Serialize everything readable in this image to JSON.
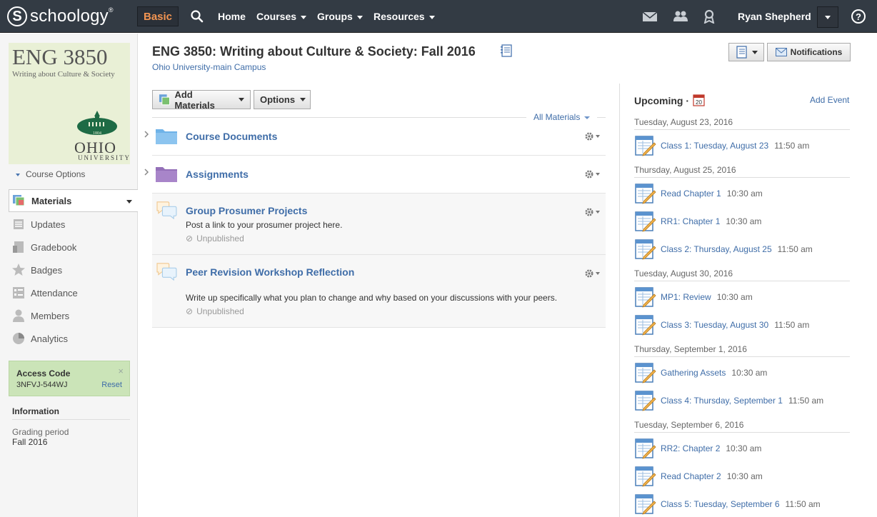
{
  "topbar": {
    "logo_letter": "S",
    "logo_text": "schoology",
    "logo_tm": "®",
    "basic_label": "Basic",
    "nav": {
      "home": "Home",
      "courses": "Courses",
      "groups": "Groups",
      "resources": "Resources"
    },
    "user_name": "Ryan Shepherd",
    "help": "?",
    "icons": [
      "mail-icon",
      "people-icon",
      "award-icon"
    ]
  },
  "sidebar": {
    "course_pic": {
      "code": "ENG 3850",
      "name": "Writing about Culture & Society",
      "ohio": "OHIO",
      "university": "UNIVERSITY",
      "seal_year": "1804"
    },
    "course_options": "Course Options",
    "items": [
      {
        "label": "Materials",
        "icon": "materials-icon"
      },
      {
        "label": "Updates",
        "icon": "updates-icon"
      },
      {
        "label": "Gradebook",
        "icon": "gradebook-icon"
      },
      {
        "label": "Badges",
        "icon": "badge-icon"
      },
      {
        "label": "Attendance",
        "icon": "attendance-icon"
      },
      {
        "label": "Members",
        "icon": "members-icon"
      },
      {
        "label": "Analytics",
        "icon": "analytics-icon"
      }
    ],
    "access": {
      "title": "Access Code",
      "code": "3NFVJ-544WJ",
      "reset": "Reset",
      "close": "×"
    },
    "info": {
      "title": "Information",
      "grading_label": "Grading period",
      "grading_value": "Fall 2016"
    }
  },
  "main": {
    "title": "ENG 3850: Writing about Culture & Society: Fall 2016",
    "campus": "Ohio University-main Campus",
    "notifications": "Notifications",
    "add_materials": "Add Materials",
    "options": "Options",
    "all_materials": "All Materials",
    "materials": [
      {
        "title": "Course Documents",
        "type": "folder",
        "color": "#6fb3e8"
      },
      {
        "title": "Assignments",
        "type": "folder",
        "color": "#a57fc4"
      },
      {
        "title": "Group Prosumer Projects",
        "type": "discussion",
        "desc": "Post a link to your prosumer project here.",
        "status": "Unpublished"
      },
      {
        "title": "Peer Revision Workshop Reflection",
        "type": "discussion",
        "desc": "Write up specifically what you plan to change and why based on your discussions with your peers.",
        "status": "Unpublished"
      }
    ]
  },
  "upcoming": {
    "title": "Upcoming ·",
    "cal_day": "20",
    "add_event": "Add Event",
    "groups": [
      {
        "date": "Tuesday, August 23, 2016",
        "events": [
          {
            "title": "Class 1: Tuesday, August 23",
            "time": "11:50 am"
          }
        ]
      },
      {
        "date": "Thursday, August 25, 2016",
        "events": [
          {
            "title": "Read Chapter 1",
            "time": "10:30 am"
          },
          {
            "title": "RR1: Chapter 1",
            "time": "10:30 am"
          },
          {
            "title": "Class 2: Thursday, August 25",
            "time": "11:50 am"
          }
        ]
      },
      {
        "date": "Tuesday, August 30, 2016",
        "events": [
          {
            "title": "MP1: Review",
            "time": "10:30 am"
          },
          {
            "title": "Class 3: Tuesday, August 30",
            "time": "11:50 am"
          }
        ]
      },
      {
        "date": "Thursday, September 1, 2016",
        "events": [
          {
            "title": "Gathering Assets",
            "time": "10:30 am"
          },
          {
            "title": "Class 4: Thursday, September 1",
            "time": "11:50 am"
          }
        ]
      },
      {
        "date": "Tuesday, September 6, 2016",
        "events": [
          {
            "title": "RR2: Chapter 2",
            "time": "10:30 am"
          },
          {
            "title": "Read Chapter 2",
            "time": "10:30 am"
          },
          {
            "title": "Class 5: Tuesday, September 6",
            "time": "11:50 am"
          }
        ]
      }
    ]
  }
}
